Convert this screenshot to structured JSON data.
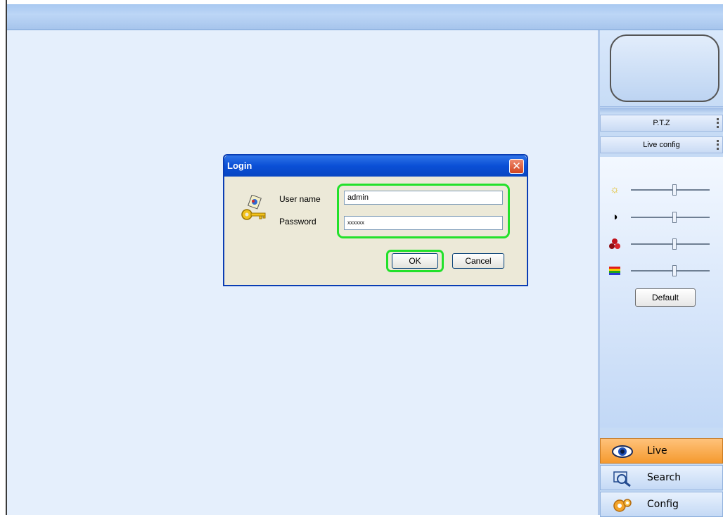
{
  "right_panel": {
    "tabs": [
      "P.T.Z",
      "Live config"
    ],
    "sliders": [
      {
        "icon": "brightness-icon",
        "value_fraction": 0.55
      },
      {
        "icon": "contrast-icon",
        "value_fraction": 0.55
      },
      {
        "icon": "saturation-icon",
        "value_fraction": 0.55
      },
      {
        "icon": "hue-icon",
        "value_fraction": 0.55
      }
    ],
    "default_label": "Default",
    "nav": [
      {
        "label": "Live",
        "icon": "eye-icon",
        "active": true
      },
      {
        "label": "Search",
        "icon": "search-magnifier-icon",
        "active": false
      },
      {
        "label": "Config",
        "icon": "config-gear-icon",
        "active": false
      }
    ]
  },
  "dialog": {
    "title": "Login",
    "username_label": "User name",
    "password_label": "Password",
    "username_value": "admin",
    "password_value": "xxxxxx",
    "ok_label": "OK",
    "cancel_label": "Cancel",
    "close_symbol": "✕"
  },
  "colors": {
    "highlight": "#22e12a",
    "active_nav": "#f59a2f",
    "title_bar": "#0a4fd6"
  }
}
